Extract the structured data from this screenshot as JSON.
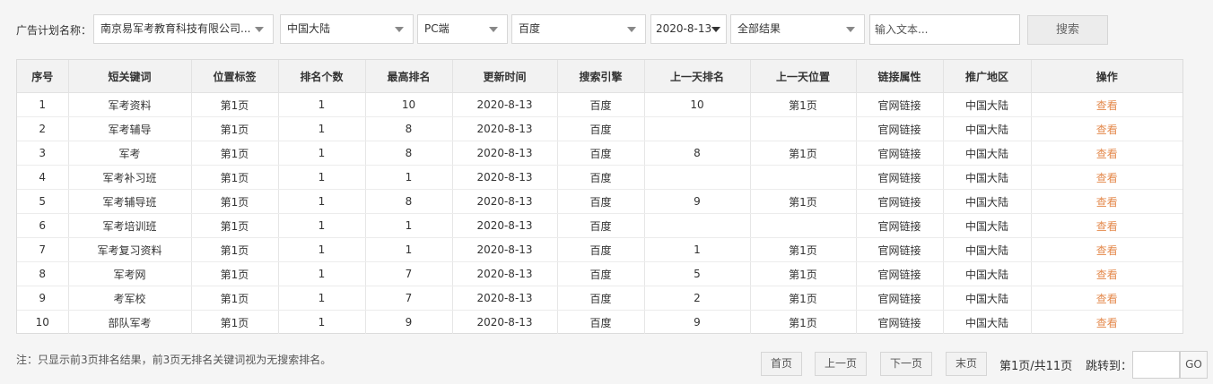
{
  "filters": {
    "plan_label": "广告计划名称：",
    "company": "南京易军考教育科技有限公司...",
    "region": "中国大陆",
    "device": "PC端",
    "engine": "百度",
    "date": "2020-8-13",
    "result": "全部结果",
    "text_placeholder": "输入文本...",
    "search_label": "搜索"
  },
  "table": {
    "headers": [
      "序号",
      "短关键词",
      "位置标签",
      "排名个数",
      "最高排名",
      "更新时间",
      "搜索引擎",
      "上一天排名",
      "上一天位置",
      "链接属性",
      "推广地区",
      "操作"
    ],
    "rows": [
      [
        "1",
        "军考资料",
        "第1页",
        "1",
        "10",
        "2020-8-13",
        "百度",
        "10",
        "第1页",
        "官网链接",
        "中国大陆",
        "查看"
      ],
      [
        "2",
        "军考辅导",
        "第1页",
        "1",
        "8",
        "2020-8-13",
        "百度",
        "",
        "",
        "官网链接",
        "中国大陆",
        "查看"
      ],
      [
        "3",
        "军考",
        "第1页",
        "1",
        "8",
        "2020-8-13",
        "百度",
        "8",
        "第1页",
        "官网链接",
        "中国大陆",
        "查看"
      ],
      [
        "4",
        "军考补习班",
        "第1页",
        "1",
        "1",
        "2020-8-13",
        "百度",
        "",
        "",
        "官网链接",
        "中国大陆",
        "查看"
      ],
      [
        "5",
        "军考辅导班",
        "第1页",
        "1",
        "8",
        "2020-8-13",
        "百度",
        "9",
        "第1页",
        "官网链接",
        "中国大陆",
        "查看"
      ],
      [
        "6",
        "军考培训班",
        "第1页",
        "1",
        "1",
        "2020-8-13",
        "百度",
        "",
        "",
        "官网链接",
        "中国大陆",
        "查看"
      ],
      [
        "7",
        "军考复习资料",
        "第1页",
        "1",
        "1",
        "2020-8-13",
        "百度",
        "1",
        "第1页",
        "官网链接",
        "中国大陆",
        "查看"
      ],
      [
        "8",
        "军考网",
        "第1页",
        "1",
        "7",
        "2020-8-13",
        "百度",
        "5",
        "第1页",
        "官网链接",
        "中国大陆",
        "查看"
      ],
      [
        "9",
        "考军校",
        "第1页",
        "1",
        "7",
        "2020-8-13",
        "百度",
        "2",
        "第1页",
        "官网链接",
        "中国大陆",
        "查看"
      ],
      [
        "10",
        "部队军考",
        "第1页",
        "1",
        "9",
        "2020-8-13",
        "百度",
        "9",
        "第1页",
        "官网链接",
        "中国大陆",
        "查看"
      ]
    ]
  },
  "footer": {
    "note": "注：只显示前3页排名结果，前3页无排名关键词视为无搜索排名。",
    "first": "首页",
    "prev": "上一页",
    "next": "下一页",
    "last": "末页",
    "page_info": "第1页/共11页",
    "jump_label": "跳转到：",
    "go": "GO"
  }
}
